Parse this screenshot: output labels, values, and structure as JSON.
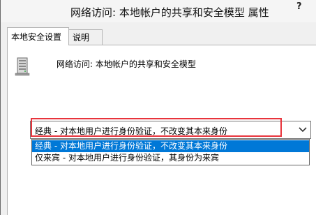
{
  "window": {
    "title": "网络访问: 本地帐户的共享和安全模型 属性",
    "help_label": "?"
  },
  "tabs": [
    {
      "label": "本地安全设置",
      "active": true
    },
    {
      "label": "说明",
      "active": false
    }
  ],
  "policy": {
    "name": "网络访问: 本地帐户的共享和安全模型",
    "icon": "server-icon"
  },
  "select": {
    "value": "经典 - 对本地用户进行身份验证，不改变其本来身份",
    "chevron_icon": "chevron-down-icon",
    "highlight_color": "#e8343c"
  },
  "dropdown": {
    "options": [
      {
        "label": "经典 - 对本地用户进行身份验证，不改变其本来身份",
        "selected": true
      },
      {
        "label": "仅来宾 - 对本地用户进行身份验证，其身份为来宾",
        "selected": false
      }
    ],
    "selected_color": "#0078d7"
  }
}
